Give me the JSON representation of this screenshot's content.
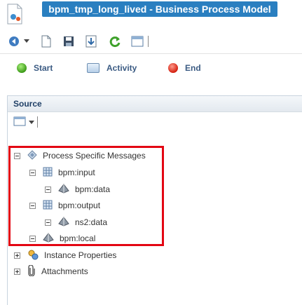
{
  "window": {
    "title": "bpm_tmp_long_lived - Business Process Model"
  },
  "toolbar": {
    "icons": [
      "navigate-icon",
      "dropdown-icon",
      "new-icon",
      "save-icon",
      "export-icon",
      "refresh-icon",
      "window-icon"
    ]
  },
  "palette": {
    "items": [
      {
        "label": "Start",
        "icon": "start-circle-icon"
      },
      {
        "label": "Activity",
        "icon": "activity-icon"
      },
      {
        "label": "End",
        "icon": "end-circle-icon"
      }
    ]
  },
  "panel": {
    "title": "Source",
    "tree": [
      {
        "label": "Process Specific Messages",
        "expanded": true
      },
      {
        "label": "bpm:input",
        "expanded": true
      },
      {
        "label": "bpm:data",
        "expanded": true
      },
      {
        "label": "bpm:output",
        "expanded": true
      },
      {
        "label": "ns2:data",
        "expanded": true
      },
      {
        "label": "bpm:local",
        "expanded": true
      },
      {
        "label": "Instance Properties",
        "expanded": false
      },
      {
        "label": "Attachments",
        "expanded": false
      }
    ]
  },
  "colors": {
    "title_bg": "#2a7fc0",
    "highlight": "#e30613",
    "accent_text": "#3b5b83"
  }
}
